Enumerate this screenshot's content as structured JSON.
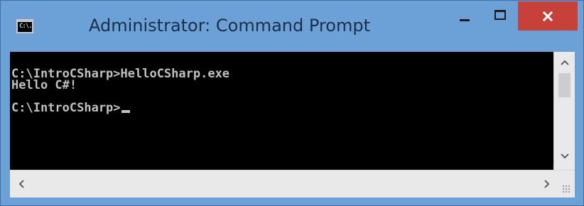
{
  "window": {
    "title": "Administrator: Command Prompt",
    "icon_label": "C:\\.",
    "colors": {
      "frame": "#6ba1d6",
      "close_button": "#c7413a",
      "console_background": "#000000",
      "console_text": "#c0c0c0"
    }
  },
  "console": {
    "lines": [
      "C:\\IntroCSharp>HelloCSharp.exe",
      "Hello C#!",
      "",
      "C:\\IntroCSharp>"
    ]
  },
  "icons": {
    "app": "console-icon",
    "minimize": "minimize-icon",
    "maximize": "maximize-icon",
    "close": "close-icon",
    "scroll_up": "chevron-up-icon",
    "scroll_down": "chevron-down-icon",
    "scroll_left": "chevron-left-icon",
    "scroll_right": "chevron-right-icon",
    "resize_grip": "resize-grip-icon"
  }
}
